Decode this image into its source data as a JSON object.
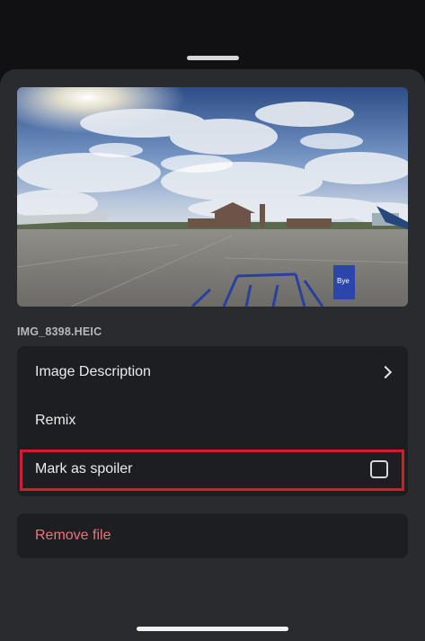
{
  "attachment": {
    "file_name": "IMG_8398.HEIC",
    "preview_alt": "Airport apron with control tower and cloudy sky"
  },
  "menu": {
    "image_description_label": "Image Description",
    "remix_label": "Remix",
    "spoiler_label": "Mark as spoiler",
    "spoiler_checked": false
  },
  "remove": {
    "label": "Remove file"
  },
  "colors": {
    "sheet_bg": "#2a2b2f",
    "card_bg": "#1d1e22",
    "danger_text": "#f0717a",
    "highlight_border": "#d31d2c"
  }
}
